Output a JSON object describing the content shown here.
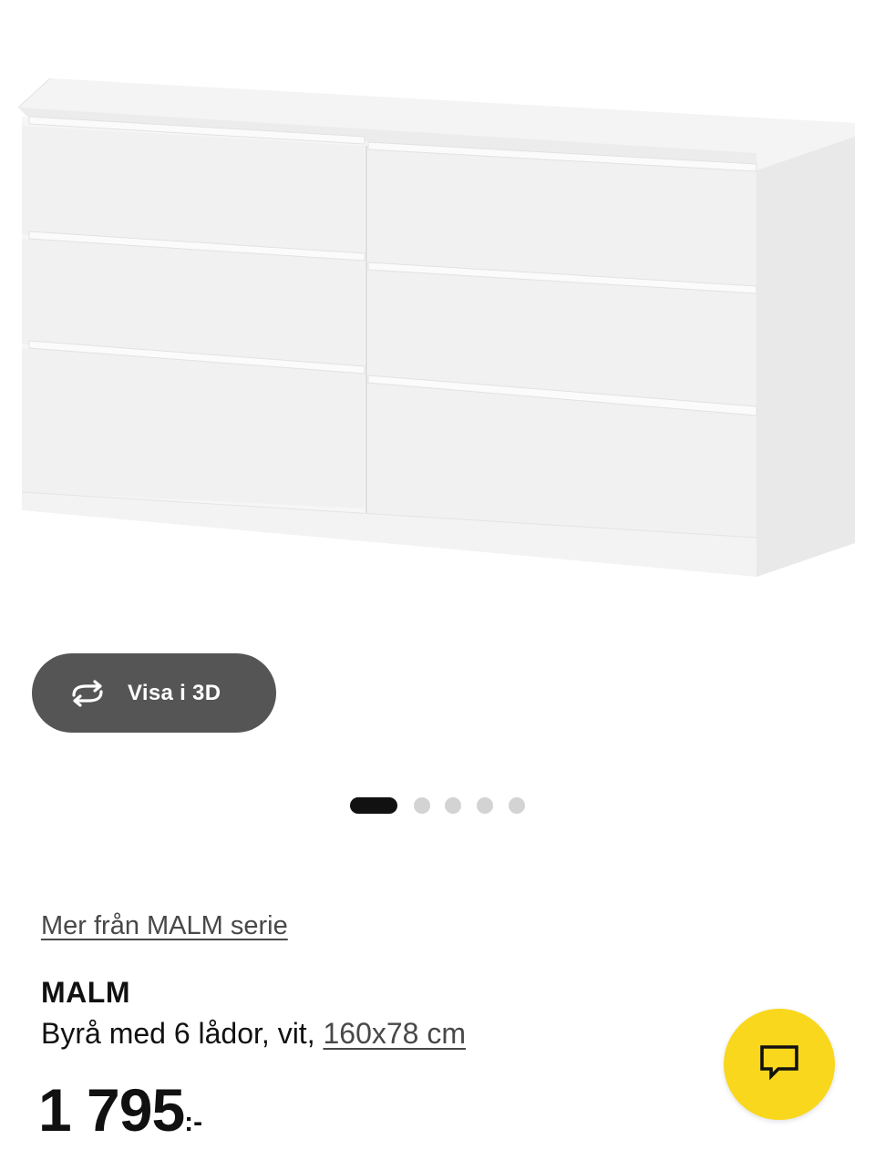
{
  "product_image": {
    "icon": "dresser-6-drawers-white-image"
  },
  "view3d": {
    "label": "Visa i 3D",
    "icon": "rotate-3d-icon"
  },
  "pager": {
    "total": 5,
    "active_index": 0
  },
  "series_link": {
    "label": "Mer från MALM serie"
  },
  "product": {
    "name": "MALM",
    "description": "Byrå med 6 lådor, vit, ",
    "size": "160x78 cm"
  },
  "price": {
    "integer": "1 795",
    "suffix": ":-"
  },
  "chat": {
    "icon": "chat-bubble-icon"
  },
  "colors": {
    "button_dark": "#555555",
    "chat_yellow": "#f9d71c",
    "dot_inactive": "#d3d3d3",
    "dot_active": "#111111",
    "link_text": "#484848"
  }
}
